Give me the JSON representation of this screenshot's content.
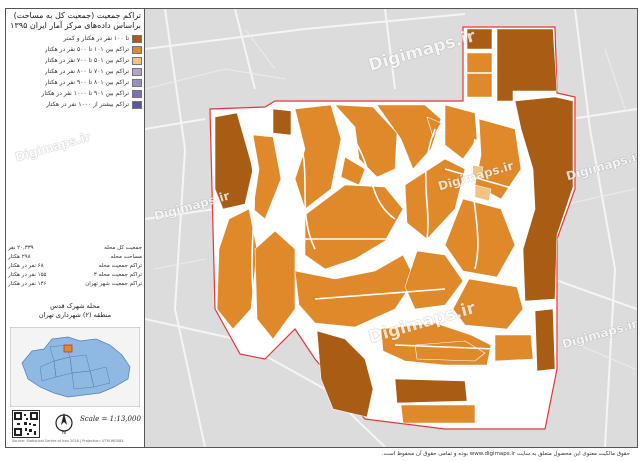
{
  "legend": {
    "title_line1": "تراکم جمعیت (جمعیت کل به مساحت)",
    "title_line2": "براساس داده‌های مرکز آمار ایران ۱۳۹۵",
    "classes": [
      {
        "label": "تا ۱۰۰ نفر در هکتار و کمتر",
        "color": "#a85c14"
      },
      {
        "label": "تراکم بین ۱۰۱ تا ۵۰۰ نفر در هکتار",
        "color": "#e0892a"
      },
      {
        "label": "تراکم بین ۵۰۱ تا ۷۰۰ نفر در هکتار",
        "color": "#f3c47f"
      },
      {
        "label": "تراکم بین ۷۰۱ تا ۸۰۰ نفر در هکتار",
        "color": "#b3a7cf"
      },
      {
        "label": "تراکم بین ۸۰۱ تا ۹۰۰ نفر در هکتار",
        "color": "#9b8fc4"
      },
      {
        "label": "تراکم بین ۹۰۱ تا ۱۰۰۰ نفر در هکتار",
        "color": "#7e70b5"
      },
      {
        "label": "تراکم بیشتر از ۱۰۰۰ نفر در هکتار",
        "color": "#5b53a6"
      }
    ]
  },
  "stats": [
    {
      "label": "جمعیت کل محله",
      "value": "۲۰,۳۳۹ نفر"
    },
    {
      "label": "مساحت محله",
      "value": "۲۹۸ هکتار"
    },
    {
      "label": "تراکم جمعیت محله",
      "value": "۶۸ نفر در هکتار"
    },
    {
      "label": "تراکم جمعیت محله ۳",
      "value": "۱۵۵ نفر در هکتار"
    },
    {
      "label": "تراکم جمعیت شهر تهران",
      "value": "۱۴۶ نفر در هکتار"
    }
  ],
  "place": {
    "line1": "محله شهرک قدس",
    "line2": "منطقه (۲) شهرداری تهران"
  },
  "scale_label": "Scale = 1:13,000",
  "north_label": "N",
  "credit": "Source: Statistical Centre of Iran 2016 | Projection: UTM WGS84",
  "footer": "حقوق مالکیت معنوی این محصول متعلق به سایت www.digimaps.ir بوده و تمامی حقوق آن محفوظ است.",
  "watermark": "Digimaps.ir",
  "watermark_small": "Digimaps.ir",
  "colors": {
    "dark": "#a85c14",
    "medium": "#e0892a",
    "boundary": "#e8343c",
    "road": "#ffffff",
    "background": "#dcdcdc"
  }
}
